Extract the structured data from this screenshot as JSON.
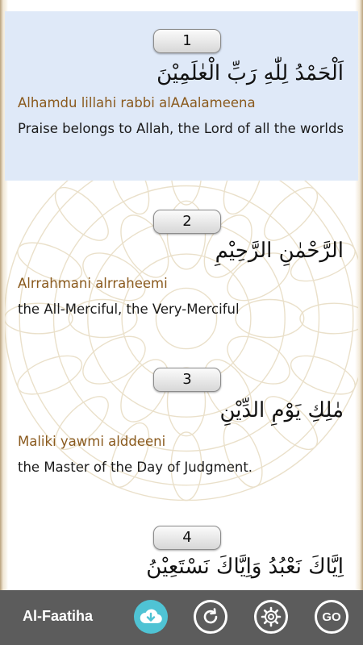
{
  "verses": [
    {
      "number": "1",
      "arabic": "اَلْحَمْدُ لِلّٰهِ رَبِّ الْعٰلَمِيْنَ",
      "transliteration": "Alhamdu lillahi rabbi alAAalameena",
      "translation": "Praise belongs to Allah, the Lord of all the worlds"
    },
    {
      "number": "2",
      "arabic": "الرَّحْمٰنِ الرَّحِيْمِ",
      "transliteration": "Alrrahmani alrraheemi",
      "translation": "the All-Merciful, the Very-Merciful"
    },
    {
      "number": "3",
      "arabic": "مٰلِكِ يَوْمِ الدِّيْنِ",
      "transliteration": "Maliki yawmi alddeeni",
      "translation": "the Master of the Day of Judgment."
    },
    {
      "number": "4",
      "arabic": "اِيَّاكَ نَعْبُدُ وَاِيَّاكَ نَسْتَعِيْنُ"
    }
  ],
  "bottom_bar": {
    "sura_name": "Al-Faatiha",
    "go_label": "GO",
    "icons": [
      "cloud-download-icon",
      "refresh-icon",
      "gear-icon",
      "go-icon"
    ]
  },
  "colors": {
    "highlight": "#dfe9f8",
    "transliteration": "#8a5a1e",
    "bar": "#5c5c5c",
    "cloud_button": "#4fc3d4"
  }
}
